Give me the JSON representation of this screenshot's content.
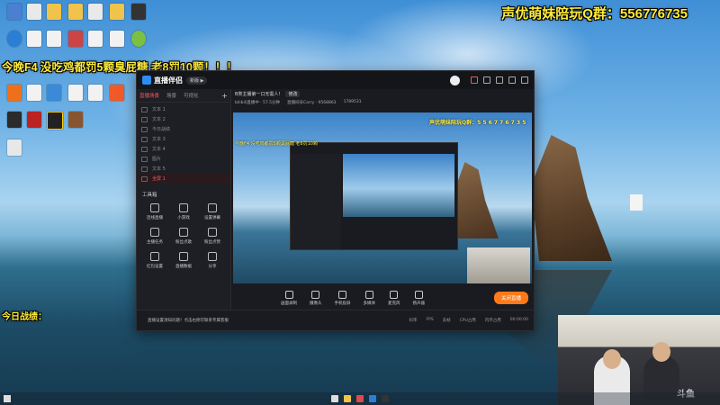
{
  "overlay": {
    "top_banner": "声优萌妹陪玩Q群：556776735",
    "left_banner": "今晚F4  没吃鸡都罚5颗臭屁糖 老8罚10颗！！！",
    "today_result": "今日战绩："
  },
  "app": {
    "name": "直播伴侣",
    "edition_tag": "新版 ▶",
    "tabs": [
      "直播场景",
      "场景",
      "可视化"
    ],
    "scenes": [
      "文本 1",
      "文本 2",
      "今日战绩",
      "文本 3",
      "文本 4",
      "图片",
      "文本 5",
      "全屏 1"
    ],
    "active_scene": "全屏 1",
    "tools_title": "工具箱",
    "tools": [
      "连线直播",
      "小游戏",
      "设置弹幕",
      "主播任务",
      "粉丝点歌",
      "粉丝点赞",
      "红包设置",
      "直播数据",
      "分享"
    ],
    "subbar_text": "B类主播第一口无需人!",
    "subbar_chip": "修改",
    "stats": [
      "bilibili直播中 · 57.5分钟",
      "直播间号Carry · 9568863",
      "1789531"
    ],
    "preview_label": "声优萌妹陪玩Q群：5 5 6 7 7 6 7 3 5",
    "preview_label2": "今晚F4 没吃鸡都罚5颗臭屁糖 老8罚10颗",
    "controls": [
      "画面录制",
      "摄像头",
      "手机投屏",
      "多媒体",
      "麦克风",
      "扬声器"
    ],
    "start_button": "关闭直播",
    "notice": "直播设置须知问题！点击右侧可联系专属客服",
    "status_right": [
      "码率",
      "FPS",
      "丢帧",
      "CPU占用",
      "内存占用",
      "00:00:00"
    ]
  },
  "webcam": {
    "watermark": "斗鱼"
  }
}
